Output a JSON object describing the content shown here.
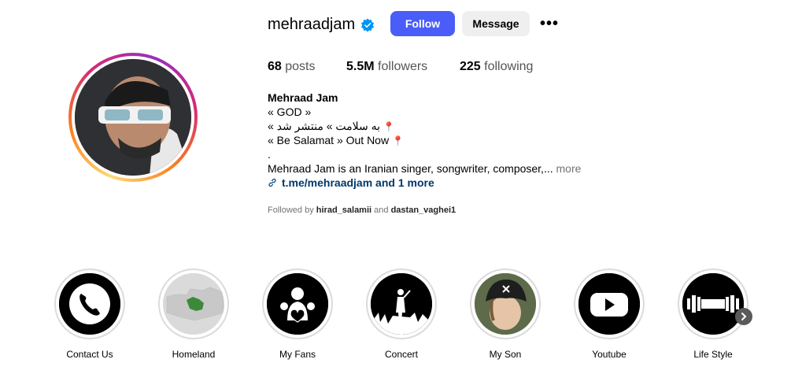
{
  "profile": {
    "username": "mehraadjam",
    "follow_label": "Follow",
    "message_label": "Message",
    "more_label": "•••"
  },
  "stats": {
    "posts_count": "68",
    "posts_label": "posts",
    "followers_count": "5.5M",
    "followers_label": "followers",
    "following_count": "225",
    "following_label": "following"
  },
  "bio": {
    "name": "Mehraad Jam",
    "line1": "« GOD »",
    "line2": "« به سلامت » منتشر شد",
    "line3": "« Be Salamat » Out Now",
    "line4": ".",
    "description": "Mehraad Jam is an Iranian singer, songwriter, composer,...",
    "more_label": "more",
    "link_text": "t.me/mehraadjam and 1 more",
    "followed_prefix": "Followed by",
    "followed_user1": "hirad_salamii",
    "followed_and": "and",
    "followed_user2": "dastan_vaghei1"
  },
  "highlights": [
    {
      "label": "Contact Us",
      "icon": "phone-icon"
    },
    {
      "label": "Homeland",
      "icon": "globe-map-icon"
    },
    {
      "label": "My Fans",
      "icon": "fans-heart-icon"
    },
    {
      "label": "Concert",
      "icon": "concert-icon"
    },
    {
      "label": "My Son",
      "icon": "son-photo"
    },
    {
      "label": "Youtube",
      "icon": "youtube-icon"
    },
    {
      "label": "Life Style",
      "icon": "dumbbell-icon"
    }
  ],
  "colors": {
    "follow_button": "#4a5df9",
    "verified_badge": "#0095f6",
    "link": "#00376b"
  }
}
